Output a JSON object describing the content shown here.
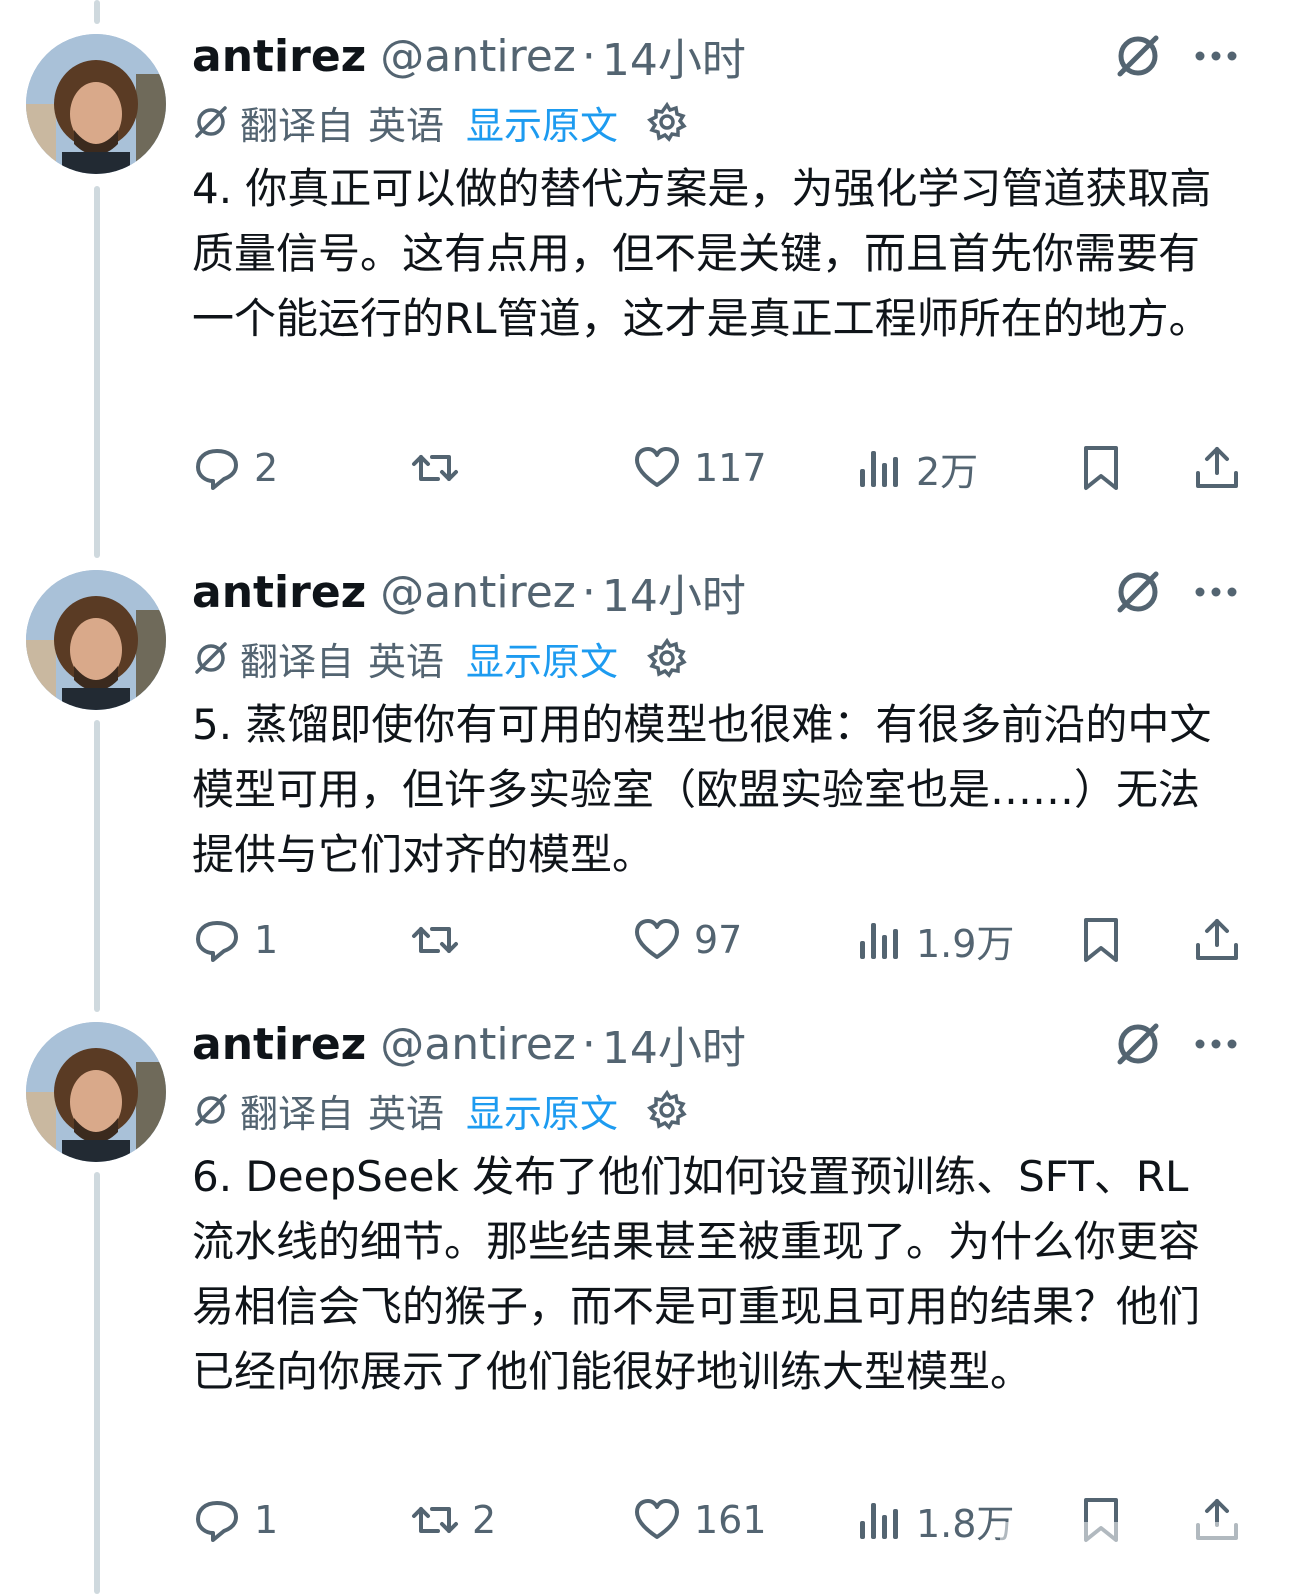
{
  "tweets": [
    {
      "author_name": "antirez",
      "handle": "@antirez",
      "separator": "·",
      "time": "14小时",
      "translated_from": "翻译自",
      "language": "英语",
      "show_original": "显示原文",
      "text": "4. 你真正可以做的替代方案是，为强化学习管道获取高质量信号。这有点用，但不是关键，而且首先你需要有一个能运行的RL管道，这才是真正工程师所在的地方。",
      "replies": "2",
      "retweets": "",
      "likes": "117",
      "views": "2万"
    },
    {
      "author_name": "antirez",
      "handle": "@antirez",
      "separator": "·",
      "time": "14小时",
      "translated_from": "翻译自",
      "language": "英语",
      "show_original": "显示原文",
      "text": "5. 蒸馏即使你有可用的模型也很难：有很多前沿的中文模型可用，但许多实验室（欧盟实验室也是……）无法提供与它们对齐的模型。",
      "replies": "1",
      "retweets": "",
      "likes": "97",
      "views": "1.9万"
    },
    {
      "author_name": "antirez",
      "handle": "@antirez",
      "separator": "·",
      "time": "14小时",
      "translated_from": "翻译自",
      "language": "英语",
      "show_original": "显示原文",
      "text": "6. DeepSeek 发布了他们如何设置预训练、SFT、RL 流水线的细节。那些结果甚至被重现了。为什么你更容易相信会飞的猴子，而不是可重现且可用的结果？他们已经向你展示了他们能很好地训练大型模型。",
      "replies": "1",
      "retweets": "2",
      "likes": "161",
      "views": "1.8万"
    }
  ],
  "icons": {
    "reply": "reply-icon",
    "retweet": "retweet-icon",
    "like": "heart-icon",
    "views": "views-icon",
    "bookmark": "bookmark-icon",
    "share": "share-icon",
    "grok": "grok-icon",
    "more": "more-icon",
    "translate": "translate-icon",
    "settings": "gear-icon"
  },
  "colors": {
    "link": "#1d9bf0",
    "secondary_text": "#536471",
    "primary_text": "#0f1419",
    "thread_line": "#cfd9de"
  }
}
